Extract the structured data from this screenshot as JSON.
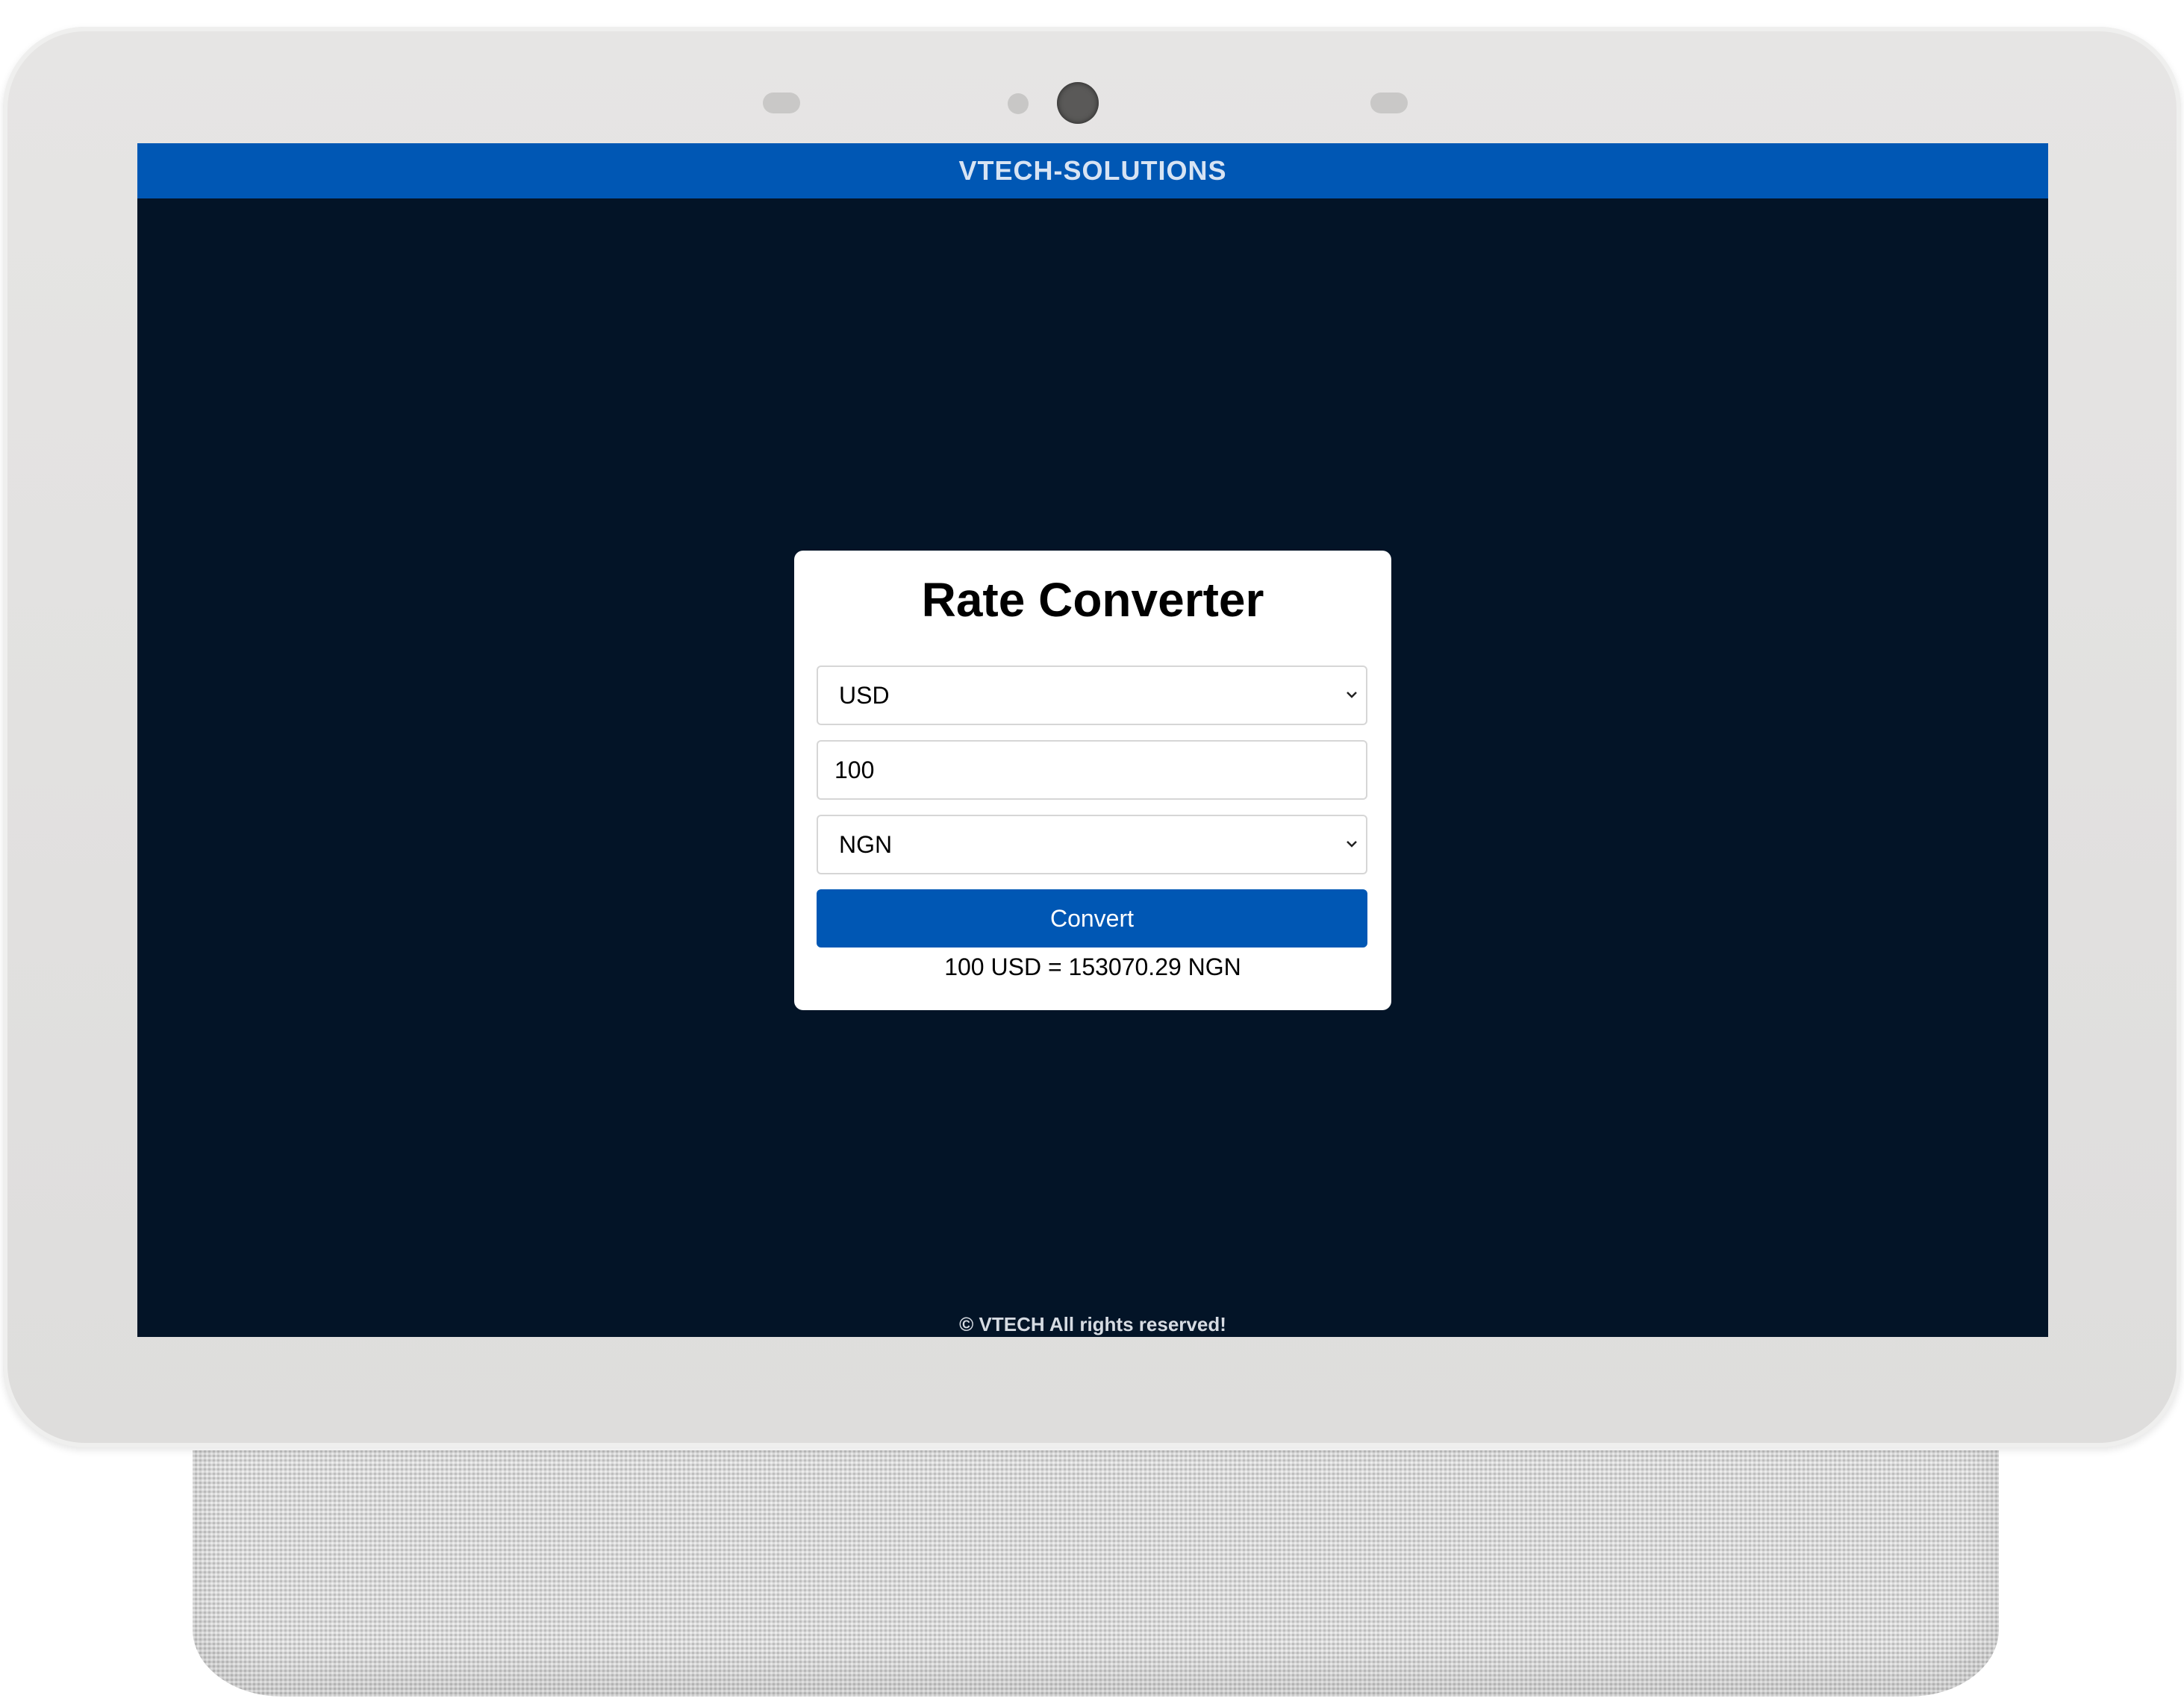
{
  "app": {
    "brand": "VTECH-SOLUTIONS",
    "footer": "© VTECH All rights reserved!"
  },
  "converter": {
    "title": "Rate Converter",
    "from_currency": "USD",
    "amount": "100",
    "to_currency": "NGN",
    "convert_label": "Convert",
    "result": "100 USD = 153070.29 NGN"
  },
  "icons": {
    "dropdown": "chevron-down-icon",
    "camera": "camera-icon"
  },
  "colors": {
    "brand_blue": "#0057b4",
    "screen_bg": "#031427",
    "card_bg": "#ffffff"
  }
}
